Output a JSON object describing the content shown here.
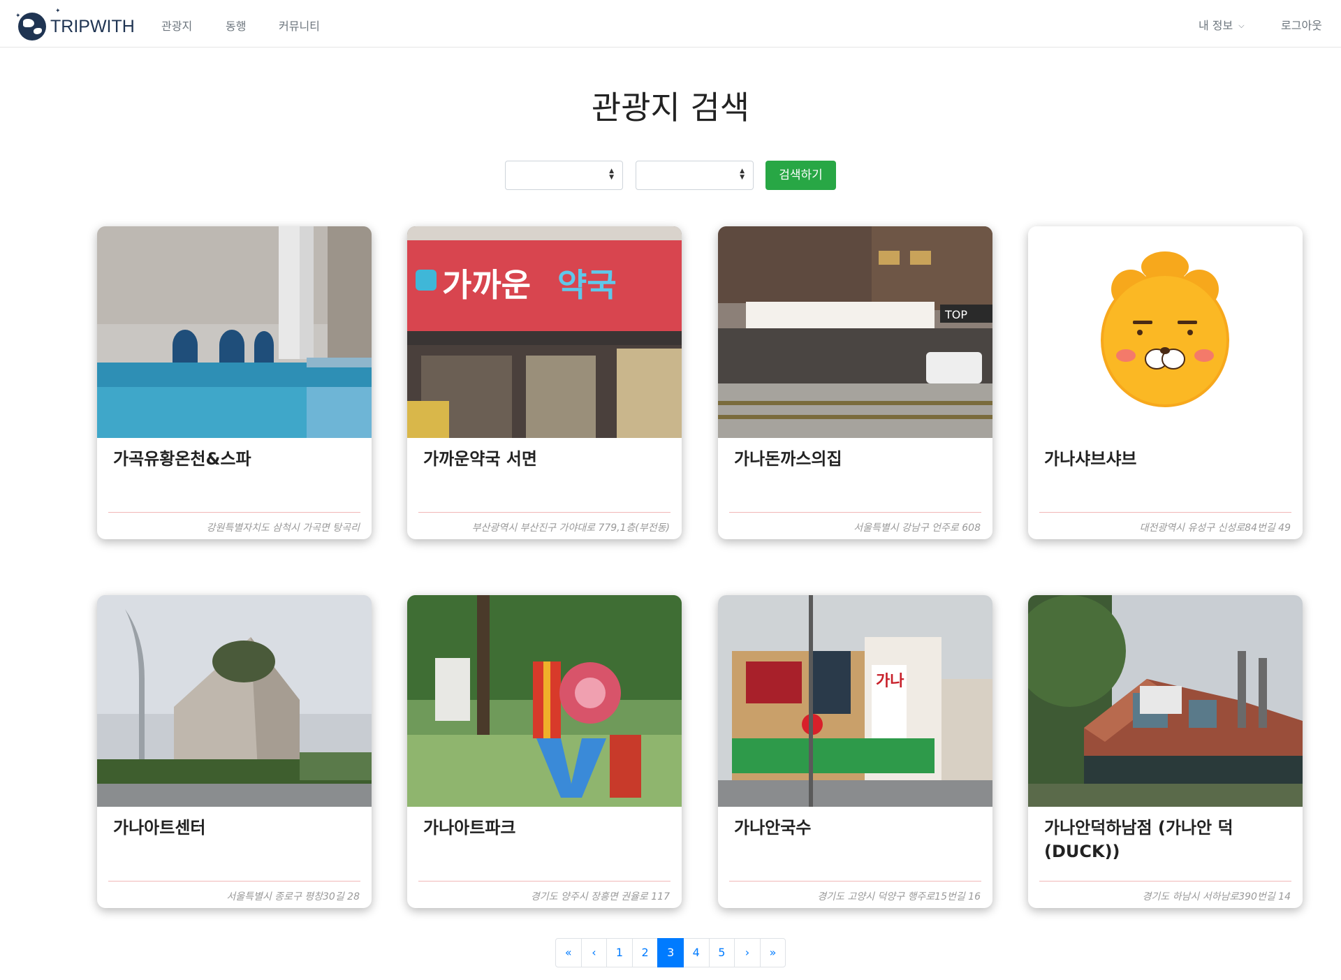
{
  "nav": {
    "logo_text": "TRIPWITH",
    "links": [
      "관광지",
      "동행",
      "커뮤니티"
    ],
    "my_info": "내 정보",
    "logout": "로그아웃"
  },
  "page": {
    "title": "관광지 검색"
  },
  "search": {
    "select1_value": "",
    "select2_value": "",
    "button_label": "검색하기"
  },
  "cards": [
    {
      "title": "가곡유황온천&스파",
      "address": "강원특별자치도 삼척시 가곡면 탕곡리",
      "image": "indoor-pool-photo"
    },
    {
      "title": "가까운약국 서면",
      "address": "부산광역시 부산진구 가야대로 779,1층(부전동)",
      "image": "pharmacy-storefront-photo"
    },
    {
      "title": "가나돈까스의집",
      "address": "서울특별시 강남구 언주로 608",
      "image": "street-building-photo"
    },
    {
      "title": "가나샤브샤브",
      "address": "대전광역시 유성구 신성로84번길 49",
      "image": "cartoon-lion-placeholder"
    },
    {
      "title": "가나아트센터",
      "address": "서울특별시 종로구 평창30길 28",
      "image": "art-center-building-photo"
    },
    {
      "title": "가나아트파크",
      "address": "경기도 양주시 장흥면 권율로 117",
      "image": "love-sculpture-park-photo"
    },
    {
      "title": "가나안국수",
      "address": "경기도 고양시 덕양구 행주로15번길 16",
      "image": "noodle-restaurant-photo"
    },
    {
      "title": "가나안덕하남점 (가나안 덕 (DUCK))",
      "address": "경기도 하남시 서하남로390번길 14",
      "image": "brick-restaurant-photo"
    }
  ],
  "pagination": {
    "items": [
      "«",
      "‹",
      "1",
      "2",
      "3",
      "4",
      "5",
      "›",
      "»"
    ],
    "active": "3"
  },
  "colors": {
    "primary": "#007bff",
    "success": "#28a745",
    "divider": "#f1b7b7",
    "logo": "#1f3452"
  }
}
